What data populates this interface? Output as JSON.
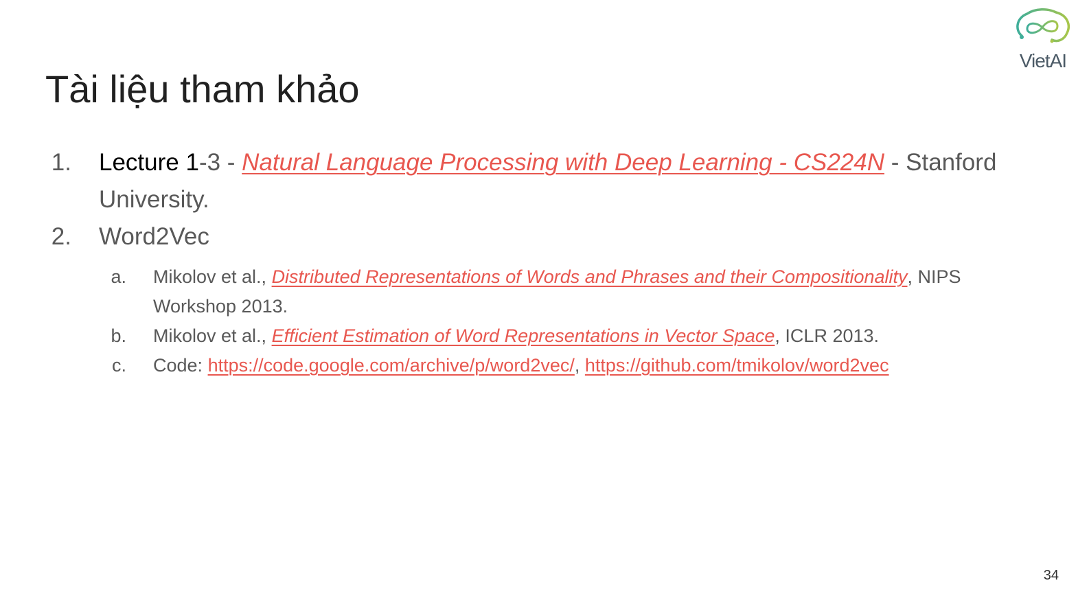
{
  "slide": {
    "title": "Tài liệu tham khảo",
    "page_number": "34"
  },
  "logo": {
    "text": "VietAI",
    "icon": "brain-infinity-logo-icon",
    "colors": [
      "#3fae9a",
      "#a8c64a",
      "#4b5a66"
    ]
  },
  "colors": {
    "link": "#e8574f",
    "body_text": "#595959",
    "title": "#212121"
  },
  "references": [
    {
      "number": "1.",
      "prefix_dark": "Lecture 1",
      "prefix_gray": "-3 - ",
      "link_text": "Natural Language Processing with Deep Learning - CS224N",
      "suffix": " - Stanford University."
    },
    {
      "number": "2.",
      "label": "Word2Vec",
      "subitems": [
        {
          "letter": "a.",
          "prefix": "Mikolov et al., ",
          "link_text": "Distributed Representations of Words and Phrases and their Compositionality",
          "suffix": ", NIPS Workshop 2013."
        },
        {
          "letter": "b.",
          "prefix": "Mikolov et al., ",
          "link_text": "Efficient Estimation of Word Representations in Vector Space",
          "suffix": ", ICLR 2013."
        },
        {
          "letter": "c.",
          "prefix": "Code: ",
          "link1_text": "https://code.google.com/archive/p/word2vec/",
          "separator": ", ",
          "link2_text": "https://github.com/tmikolov/word2vec"
        }
      ]
    }
  ]
}
